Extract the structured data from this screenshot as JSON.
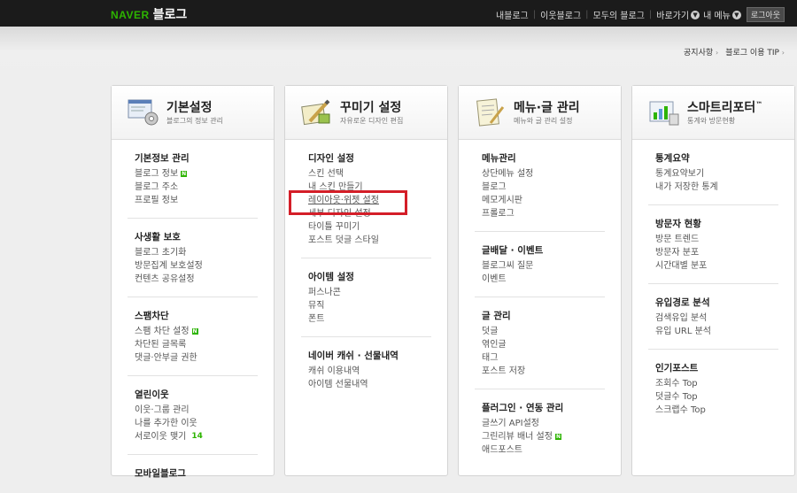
{
  "header": {
    "logo_naver": "NAVER",
    "logo_blog": "블로그",
    "nav": [
      "내블로그",
      "이웃블로그",
      "모두의 블로그"
    ],
    "shortcut": "바로가기",
    "my_menu": "내 메뉴",
    "logout": "로그아웃"
  },
  "sublinks": [
    "공지사항",
    "블로그 이용 TIP"
  ],
  "columns": [
    {
      "title": "기본설정",
      "subtitle": "블로그의 정보 관리",
      "icon": "settings-gear-icon",
      "sections": [
        {
          "title": "기본정보 관리",
          "items": [
            "블로그 정보",
            "블로그 주소",
            "프로필 정보"
          ]
        },
        {
          "title": "사생활 보호",
          "items": [
            "블로그 초기화",
            "방문집계 보호설정",
            "컨텐츠 공유설정"
          ]
        },
        {
          "title": "스팸차단",
          "items": [
            "스팸 차단 설정",
            "차단된 글목록",
            "댓글·안부글 권한"
          ]
        },
        {
          "title": "열린이웃",
          "items": [
            "이웃·그룹 관리",
            "나를 추가한 이웃",
            "서로이웃 맺기"
          ],
          "count": "14"
        },
        {
          "title": "모바일블로그",
          "items": []
        }
      ]
    },
    {
      "title": "꾸미기 설정",
      "subtitle": "자유로운 디자인 편집",
      "icon": "design-pencil-icon",
      "sections": [
        {
          "title": "디자인 설정",
          "items": [
            "스킨 선택",
            "내 스킨 만들기",
            "레이아웃·위젯 설정",
            "세부 디자인 설정",
            "타이틀 꾸미기",
            "포스트 덧글 스타일"
          ]
        },
        {
          "title": "아이템 설정",
          "items": [
            "퍼스나콘",
            "뮤직",
            "폰트"
          ]
        },
        {
          "title": "네이버 캐쉬 · 선물내역",
          "items": [
            "캐쉬 이용내역",
            "아이템 선물내역"
          ]
        }
      ]
    },
    {
      "title": "메뉴·글 관리",
      "subtitle": "메뉴와 글 관리 설정",
      "icon": "document-menu-icon",
      "sections": [
        {
          "title": "메뉴관리",
          "items": [
            "상단메뉴 설정",
            "블로그",
            "메모게시판",
            "프롤로그"
          ]
        },
        {
          "title": "글배달 · 이벤트",
          "items": [
            "블로그씨 질문",
            "이벤트"
          ]
        },
        {
          "title": "글 관리",
          "items": [
            "덧글",
            "엮인글",
            "태그",
            "포스트 저장"
          ]
        },
        {
          "title": "플러그인 · 연동 관리",
          "items": [
            "글쓰기 API설정",
            "그린리뷰 배너 설정",
            "애드포스트"
          ]
        }
      ]
    },
    {
      "title": "스마트리포터",
      "title_mark": "™",
      "subtitle": "통계와 방문현황",
      "icon": "statistics-chart-icon",
      "sections": [
        {
          "title": "통계요약",
          "items": [
            "통계요약보기",
            "내가 저장한 통계"
          ]
        },
        {
          "title": "방문자 현황",
          "items": [
            "방문 트렌드",
            "방문자 분포",
            "시간대별 분포"
          ]
        },
        {
          "title": "유입경로 분석",
          "items": [
            "검색유입 분석",
            "유입 URL 분석"
          ]
        },
        {
          "title": "인기포스트",
          "items": [
            "조회수 Top",
            "덧글수 Top",
            "스크랩수 Top"
          ]
        }
      ]
    }
  ],
  "colors": {
    "topbar": "#1b1b1b",
    "naver_green": "#2db400",
    "highlight": "#d41e28"
  }
}
